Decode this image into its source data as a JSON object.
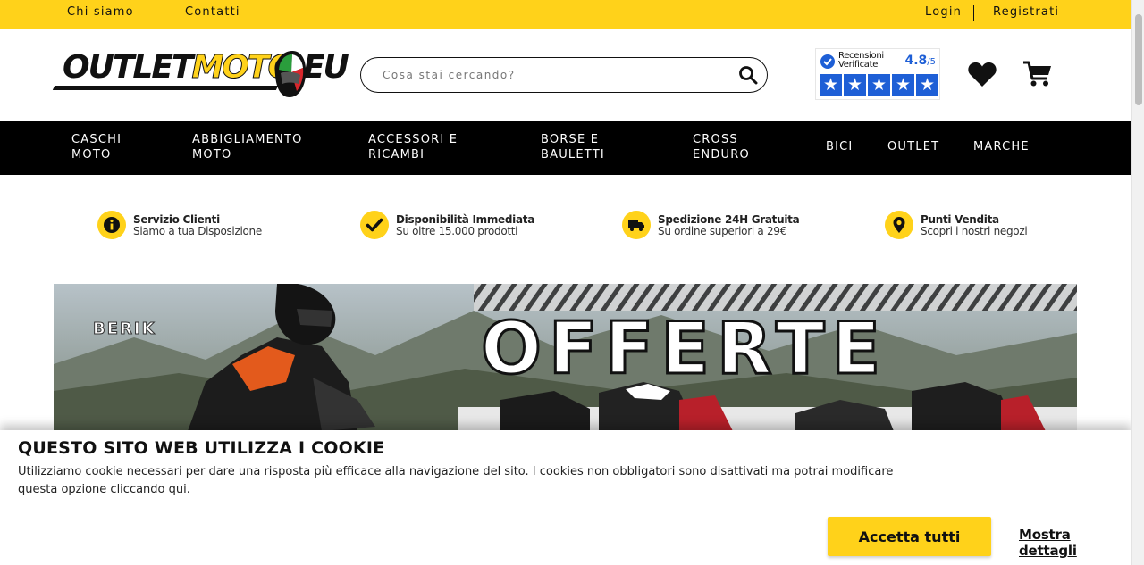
{
  "topbar": {
    "about": "Chi siamo",
    "contacts": "Contatti",
    "login": "Login",
    "register": "Registrati"
  },
  "header": {
    "logo": {
      "part1": "OUTLET",
      "part2": "MOTO",
      "part3": ".EU"
    },
    "search": {
      "placeholder": "Cosa stai cercando?",
      "value": ""
    },
    "reviews": {
      "title_line1": "Recensioni",
      "title_line2": "Verificate",
      "score": "4.8",
      "max": "/5",
      "stars": 5
    },
    "icons": {
      "wishlist": "heart-icon",
      "cart": "cart-icon",
      "search": "search-icon"
    }
  },
  "nav": {
    "items": [
      {
        "label": "CASCHI\nMOTO"
      },
      {
        "label": "ABBIGLIAMENTO\nMOTO"
      },
      {
        "label": "ACCESSORI E\nRICAMBI"
      },
      {
        "label": "BORSE E\nBAULETTI"
      },
      {
        "label": "CROSS\nENDURO"
      },
      {
        "label": "BICI"
      },
      {
        "label": "OUTLET"
      },
      {
        "label": "MARCHE"
      }
    ]
  },
  "features": [
    {
      "title": "Servizio Clienti",
      "subtitle": "Siamo a tua Disposizione",
      "icon": "info-icon"
    },
    {
      "title": "Disponibilità Immediata",
      "subtitle": "Su oltre 15.000 prodotti",
      "icon": "check-icon"
    },
    {
      "title": "Spedizione 24H Gratuita",
      "subtitle": "Su ordine superiori a 29€",
      "icon": "truck-icon"
    },
    {
      "title": "Punti Vendita",
      "subtitle": "Scopri i nostri negozi",
      "icon": "location-icon"
    }
  ],
  "banner": {
    "brand": "BERIK",
    "headline": "OFFERTE"
  },
  "cookie": {
    "title": "QUESTO SITO WEB UTILIZZA I COOKIE",
    "description": "Utilizziamo cookie necessari per dare una risposta più efficace alla navigazione del sito. I cookies non obbligatori sono disattivati ma potrai modificare questa opzione cliccando qui.",
    "accept": "Accetta tutti",
    "details": "Mostra dettagli"
  },
  "colors": {
    "accent": "#ffd21a",
    "nav_bg": "#000000",
    "review_blue": "#1e5fd6"
  }
}
